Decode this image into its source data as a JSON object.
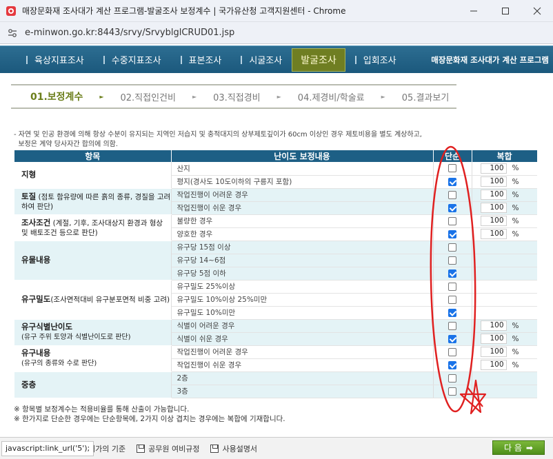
{
  "window": {
    "title": "매장문화재 조사대가 계산 프로그램-발굴조사 보정계수 | 국가유산청 고객지원센터 - Chrome",
    "url": "e-minwon.go.kr:8443/srvy/SrvyblglCRUD01.jsp"
  },
  "nav": {
    "items": [
      "육상지표조사",
      "수중지표조사",
      "표본조사",
      "시굴조사",
      "발굴조사",
      "입회조사"
    ],
    "active": "발굴조사",
    "app_name": "매장문화재 조사대가 계산 프로그램"
  },
  "steps": [
    "01.보정계수",
    "02.직접인건비",
    "03.직접경비",
    "04.제경비/학술료",
    "05.결과보기"
  ],
  "note": {
    "line1": "- 자연 및 인공 환경에 의해 항상 수분이 유지되는 지역인 저습지 및 충적대지의 상부제토깊이가 60cm 이상인 경우 제토비용을 별도 계상하고,",
    "line2": "  보정은 계약 당사자간 합의에 의함."
  },
  "table": {
    "headers": {
      "item": "항목",
      "content": "난이도 보정내용",
      "single": "단순",
      "complex": "복합"
    },
    "percent_unit": "%",
    "groups": [
      {
        "title": "지형",
        "desc": "",
        "style": "wh",
        "rows": [
          {
            "label": "산지",
            "checked": false,
            "pct": "100"
          },
          {
            "label": "평지(경사도 10도이하의 구릉지 포함)",
            "checked": true,
            "pct": "100"
          }
        ]
      },
      {
        "title": "토질",
        "desc": " (점토 함유량에 따른 흙의 종류, 경질을 고려하여 판단)",
        "style": "alt",
        "rows": [
          {
            "label": "작업진행이 어려운 경우",
            "checked": false,
            "pct": "100"
          },
          {
            "label": "작업진행이 쉬운 경우",
            "checked": true,
            "pct": "100"
          }
        ]
      },
      {
        "title": "조사조건",
        "desc": " (계절, 기후, 조사대상지 환경과 형상 및 배토조건 등으로 판단)",
        "style": "wh",
        "rows": [
          {
            "label": "불량한 경우",
            "checked": false,
            "pct": "100"
          },
          {
            "label": "양호한 경우",
            "checked": true,
            "pct": "100"
          }
        ]
      },
      {
        "title": "유물내용",
        "desc": "",
        "style": "alt",
        "rows": [
          {
            "label": "유구당 15점 이상",
            "checked": false,
            "pct": ""
          },
          {
            "label": "유구당 14~6점",
            "checked": false,
            "pct": ""
          },
          {
            "label": "유구당 5점 이하",
            "checked": true,
            "pct": ""
          }
        ]
      },
      {
        "title": "유구밀도",
        "desc": "(조사면적대비 유구분포면적 비중 고려)",
        "style": "wh",
        "rows": [
          {
            "label": "유구밀도 25%이상",
            "checked": false,
            "pct": ""
          },
          {
            "label": "유구밀도 10%이상 25%미만",
            "checked": false,
            "pct": ""
          },
          {
            "label": "유구밀도 10%미만",
            "checked": true,
            "pct": ""
          }
        ]
      },
      {
        "title": "유구식별난이도",
        "desc": "(유구 주위 토양과 식별난이도로 판단)",
        "style": "alt",
        "rows": [
          {
            "label": "식별이 어려운 경우",
            "checked": false,
            "pct": "100"
          },
          {
            "label": "식별이 쉬운 경우",
            "checked": true,
            "pct": "100"
          }
        ]
      },
      {
        "title": "유구내용",
        "desc": "(유구의 종류와 수로 판단)",
        "style": "wh",
        "rows": [
          {
            "label": "작업진행이 어려운 경우",
            "checked": false,
            "pct": "100"
          },
          {
            "label": "작업진행이 쉬운 경우",
            "checked": true,
            "pct": "100"
          }
        ]
      },
      {
        "title": "중층",
        "desc": "",
        "style": "alt",
        "rows": [
          {
            "label": "2층",
            "checked": false,
            "pct": ""
          },
          {
            "label": "3층",
            "checked": false,
            "pct": ""
          }
        ]
      }
    ]
  },
  "footnotes": [
    "※ 항목별 보정계수는 적용비율를 통해 산출이 가능합니다.",
    "※ 한가지로 단순한 경우에는 단순항목에, 2가지 이상 겹치는 경우에는 복합에 기재합니다."
  ],
  "bottom": {
    "links": [
      "대가의 기준",
      "공무원 여비규정",
      "사용설명서"
    ],
    "status_url": "javascript:link_url('5');",
    "next_label": "다 음"
  },
  "colors": {
    "nav": "#1d5f85",
    "header": "#1d5f85",
    "alt_row": "#e4f3f6",
    "active_step": "#6b7e1a",
    "annotation": "#e02020",
    "next_button": "#5c9e22"
  }
}
